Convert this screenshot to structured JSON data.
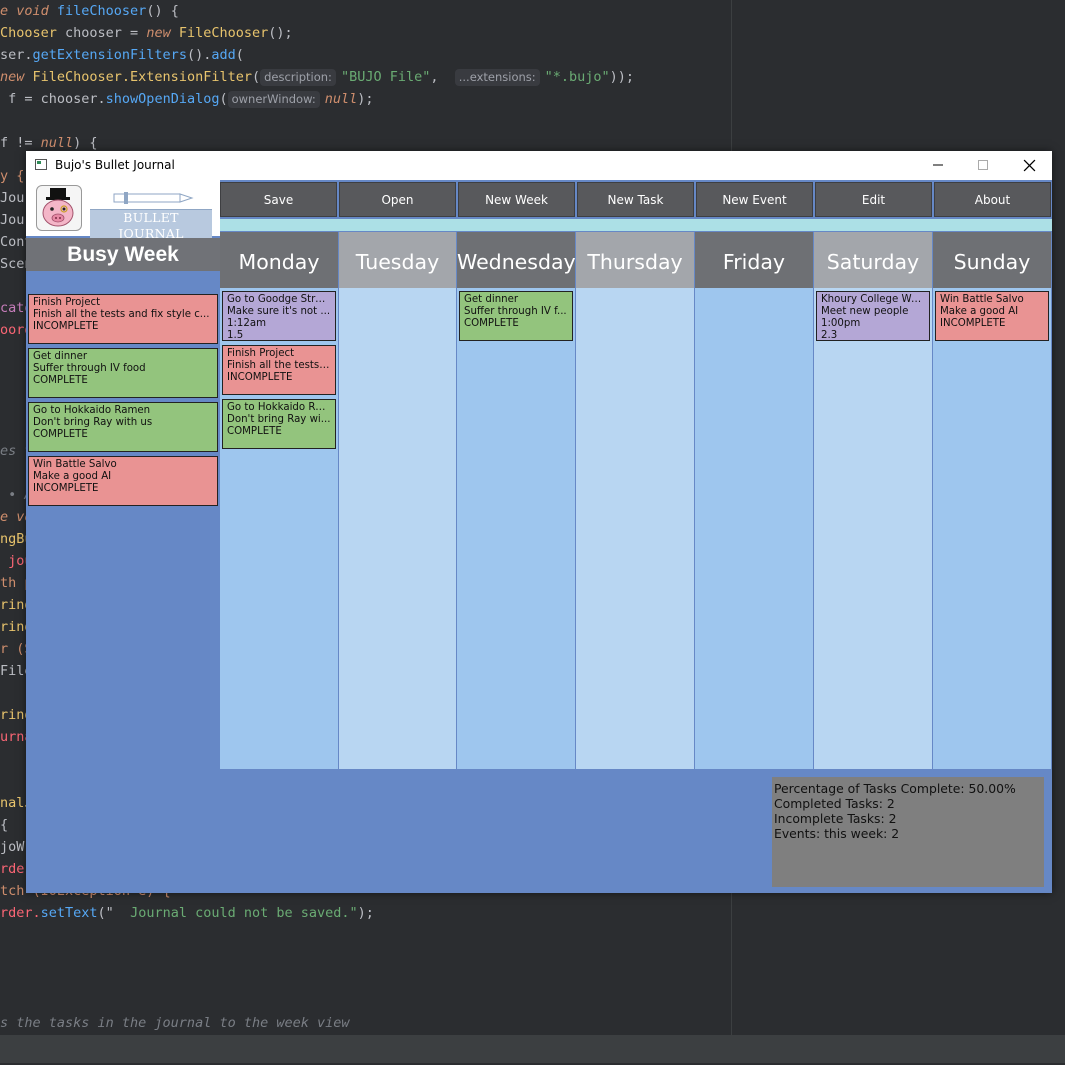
{
  "ide": {
    "code_lines": [
      {
        "parts": [
          {
            "t": "e ",
            "c": "kw"
          },
          {
            "t": "void ",
            "c": "kw"
          },
          {
            "t": "fileChooser",
            "c": "fn"
          },
          {
            "t": "() {",
            "c": ""
          }
        ]
      },
      {
        "parts": [
          {
            "t": "Chooser ",
            "c": "yel"
          },
          {
            "t": "chooser = ",
            "c": ""
          },
          {
            "t": "new ",
            "c": "kw"
          },
          {
            "t": "FileChooser",
            "c": "yel"
          },
          {
            "t": "();",
            "c": ""
          }
        ]
      },
      {
        "parts": [
          {
            "t": "ser.",
            "c": ""
          },
          {
            "t": "getExtensionFilters",
            "c": "fn"
          },
          {
            "t": "().",
            "c": ""
          },
          {
            "t": "add",
            "c": "fn"
          },
          {
            "t": "(",
            "c": ""
          }
        ]
      },
      {
        "parts": [
          {
            "t": "new ",
            "c": "kw"
          },
          {
            "t": "FileChooser.ExtensionFilter",
            "c": "yel"
          },
          {
            "t": "(",
            "c": ""
          },
          {
            "t": "description:",
            "c": "hint"
          },
          {
            "t": "\"BUJO File\"",
            "c": "str"
          },
          {
            "t": ",  ",
            "c": ""
          },
          {
            "t": "...extensions:",
            "c": "hint"
          },
          {
            "t": "\"*.bujo\"",
            "c": "str"
          },
          {
            "t": "));",
            "c": ""
          }
        ]
      },
      {
        "parts": [
          {
            "t": " f = chooser.",
            "c": ""
          },
          {
            "t": "showOpenDialog",
            "c": "fn"
          },
          {
            "t": "(",
            "c": ""
          },
          {
            "t": "ownerWindow:",
            "c": "hint"
          },
          {
            "t": "null",
            "c": "kw"
          },
          {
            "t": ");",
            "c": ""
          }
        ]
      },
      {
        "parts": []
      },
      {
        "parts": [
          {
            "t": "f != ",
            "c": ""
          },
          {
            "t": "null",
            "c": "kw"
          },
          {
            "t": ") {",
            "c": ""
          }
        ]
      }
    ],
    "left_fragments": [
      {
        "t": "y {",
        "c": "kwn"
      },
      {
        "t": "Jour",
        "c": ""
      },
      {
        "t": "Jour",
        "c": ""
      },
      {
        "t": "Cont",
        "c": ""
      },
      {
        "t": "Scen",
        "c": ""
      },
      {
        "t": "",
        "c": ""
      },
      {
        "t": "cato",
        "c": "red"
      },
      {
        "t": "oorde",
        "c": "pink"
      }
    ],
    "left_fragments_lower": [
      {
        "t": "es t",
        "c": "cmt"
      },
      {
        "t": "",
        "c": ""
      },
      {
        "t": " • A",
        "c": "cmt"
      },
      {
        "t": "e vo",
        "c": "kw"
      },
      {
        "t": "ngBu",
        "c": "yel"
      },
      {
        "t": " jou",
        "c": "pink"
      },
      {
        "t": "th p",
        "c": "kwn"
      },
      {
        "t": "ring",
        "c": "yel"
      },
      {
        "t": "ring",
        "c": "yel"
      },
      {
        "t": "r (S",
        "c": "kwn"
      },
      {
        "t": "File",
        "c": ""
      },
      {
        "t": "",
        "c": ""
      },
      {
        "t": "ring",
        "c": "yel"
      },
      {
        "t": "urna",
        "c": "pink"
      }
    ],
    "left_fragments_bottom": [
      {
        "t": "nalJ",
        "c": "yel"
      },
      {
        "t": "{",
        "c": ""
      },
      {
        "t": "joWr",
        "c": ""
      },
      {
        "t": "rder",
        "c": "pink"
      },
      {
        "t": "tch (IOException e) {",
        "c": "kwn"
      }
    ],
    "set_text_line": [
      {
        "t": "rder.",
        "c": "pink"
      },
      {
        "t": "setText",
        "c": "fn"
      },
      {
        "t": "(\"  ",
        "c": ""
      },
      {
        "t": "Journal could not be saved.\"",
        "c": "str"
      },
      {
        "t": ");",
        "c": ""
      }
    ],
    "comment_line": "s the tasks in the journal to the week view"
  },
  "window": {
    "title": "Bujo's Bullet Journal",
    "minimize_icon": "minimize-icon",
    "maximize_icon": "maximize-icon",
    "close_icon": "close-icon"
  },
  "sidebar": {
    "logo_text": "BULLET JOURNAL",
    "week_title": "Busy Week",
    "task_queue": [
      {
        "title": "Finish Project",
        "desc": "Finish all the tests and fix style c...",
        "status": "INCOMPLETE",
        "color": "red"
      },
      {
        "title": "Get dinner",
        "desc": "Suffer through IV food",
        "status": "COMPLETE",
        "color": "green"
      },
      {
        "title": "Go to Hokkaido Ramen",
        "desc": "Don't bring Ray with us",
        "status": "COMPLETE",
        "color": "green"
      },
      {
        "title": "Win Battle Salvo",
        "desc": "Make a good AI",
        "status": "INCOMPLETE",
        "color": "red"
      }
    ]
  },
  "toolbar": {
    "buttons": [
      "Save",
      "Open",
      "New Week",
      "New Task",
      "New Event",
      "Edit",
      "About"
    ]
  },
  "days": [
    {
      "name": "Monday",
      "shade": "dark",
      "items": [
        {
          "lines": [
            "Go to Goodge Street",
            "Make sure it's not ...",
            "1:12am",
            "1.5"
          ],
          "color": "purple"
        },
        {
          "lines": [
            "Finish Project",
            "Finish all the tests ...",
            "INCOMPLETE"
          ],
          "color": "red"
        },
        {
          "lines": [
            "Go to Hokkaido Ra...",
            "Don't bring Ray wi...",
            "COMPLETE"
          ],
          "color": "green"
        }
      ]
    },
    {
      "name": "Tuesday",
      "shade": "light",
      "items": []
    },
    {
      "name": "Wednesday",
      "shade": "dark",
      "items": [
        {
          "lines": [
            "Get dinner",
            "Suffer through IV f...",
            "COMPLETE"
          ],
          "color": "green"
        }
      ]
    },
    {
      "name": "Thursday",
      "shade": "light",
      "items": []
    },
    {
      "name": "Friday",
      "shade": "dark",
      "items": []
    },
    {
      "name": "Saturday",
      "shade": "light",
      "items": [
        {
          "lines": [
            "Khoury College We...",
            "Meet new people",
            "1:00pm",
            "2.3"
          ],
          "color": "purple"
        }
      ]
    },
    {
      "name": "Sunday",
      "shade": "dark",
      "items": [
        {
          "lines": [
            "Win Battle Salvo",
            "Make a good AI",
            "INCOMPLETE"
          ],
          "color": "red"
        }
      ]
    }
  ],
  "stats": {
    "percent_complete": "Percentage of Tasks Complete: 50.00%",
    "completed": "Completed Tasks: 2",
    "incomplete": "Incomplete Tasks: 2",
    "events": "Events: this week: 2"
  },
  "colors": {
    "accent_blue": "#6688c6",
    "task_red": "#e99393",
    "task_green": "#93c47d",
    "event_purple": "#b4a7d6"
  }
}
